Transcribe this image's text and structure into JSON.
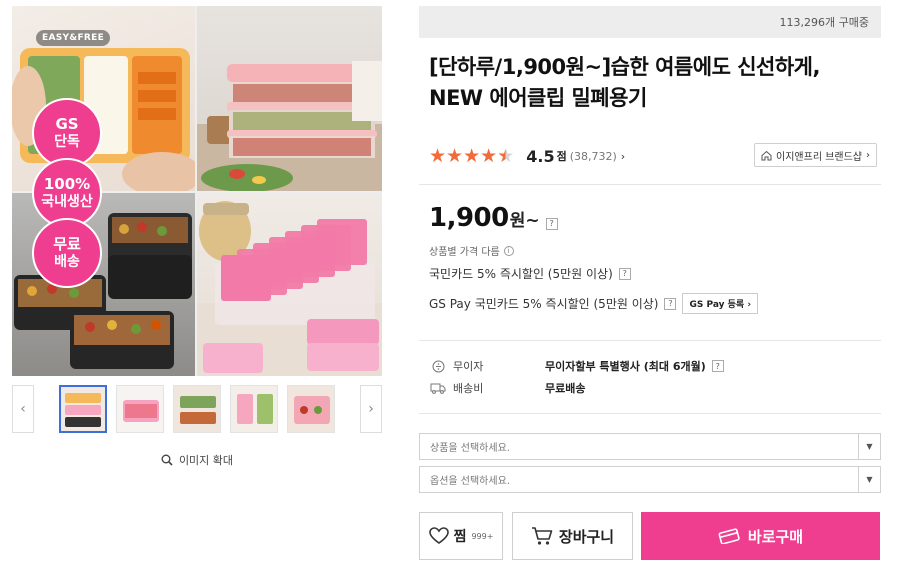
{
  "gallery": {
    "tag": "EASY&FREE",
    "badges": [
      {
        "line1": "GS",
        "line2": "단독"
      },
      {
        "line1": "100%",
        "line2": "국내생산"
      },
      {
        "line1": "무료",
        "line2": "배송"
      }
    ],
    "prev_icon": "chevron-left-icon",
    "next_icon": "chevron-right-icon",
    "zoom_label": "이미지 확대",
    "thumbnail_count": 5
  },
  "product": {
    "buying_count": "113,296개 구매중",
    "title_line1": "[단하루/1,900원~]습한 여름에도 신선하게,",
    "title_line2": "NEW 에어클립 밀폐용기",
    "rating": 4.5,
    "rating_display": "4.5",
    "rating_unit": "점",
    "review_count": "(38,732)",
    "brand_shop": "이지앤프리 브랜드샵",
    "price": "1,900",
    "price_unit": "원~",
    "price_note": "상품별 가격 다름",
    "promo1": "국민카드 5% 즉시할인 (5만원 이상)",
    "promo2": "GS Pay 국민카드 5% 즉시할인 (5만원 이상)",
    "gspay_button": "GS Pay 등록",
    "installment_label": "무이자",
    "installment_value": "무이자할부 특별행사 (최대 6개월)",
    "shipping_label": "배송비",
    "shipping_value": "무료배송"
  },
  "options": {
    "product_placeholder": "상품을 선택하세요.",
    "option_placeholder": "옵션을 선택하세요."
  },
  "actions": {
    "wish_label": "찜",
    "wish_count": "999+",
    "cart_label": "장바구니",
    "buy_label": "바로구매"
  },
  "colors": {
    "accent_pink": "#ef3e8f",
    "star_orange": "#f26b3a"
  }
}
